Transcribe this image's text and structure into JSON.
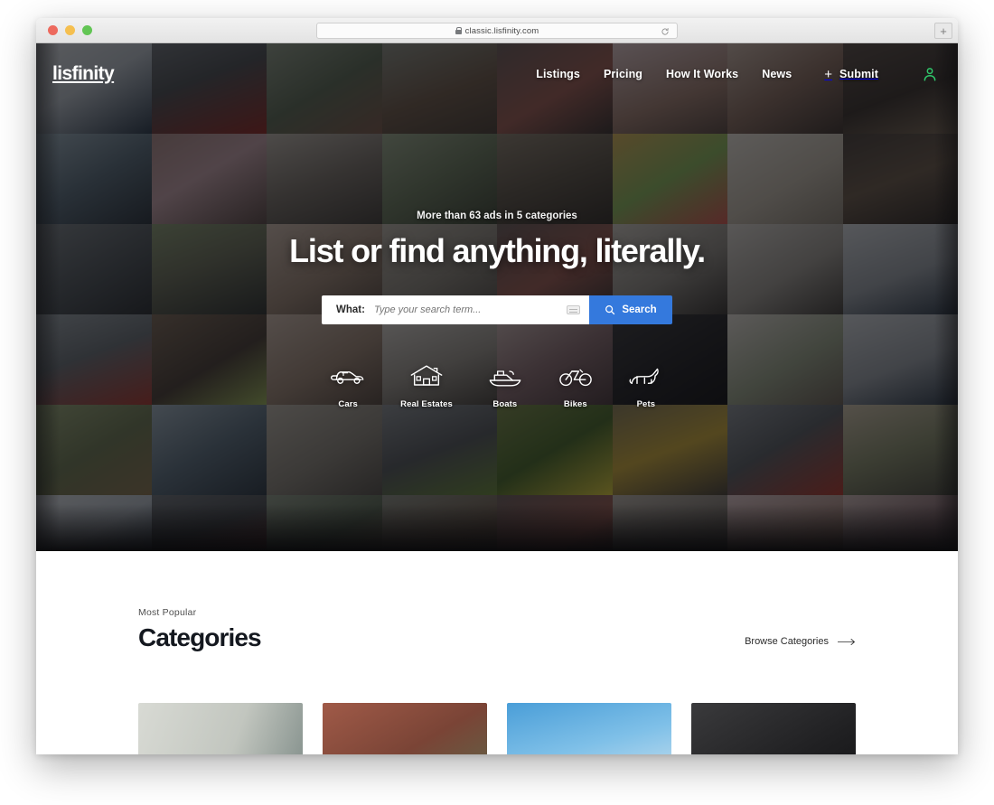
{
  "browser": {
    "url": "classic.lisfinity.com",
    "lock_icon": "lock-icon",
    "reload_icon": "reload-icon",
    "new_tab_label": "+",
    "traffic_lights": [
      "close",
      "minimize",
      "maximize"
    ]
  },
  "site": {
    "logo": "lisfinity",
    "nav": [
      {
        "label": "Listings"
      },
      {
        "label": "Pricing"
      },
      {
        "label": "How It Works"
      },
      {
        "label": "News"
      }
    ],
    "submit": {
      "icon": "plus-icon",
      "label": "Submit"
    },
    "account_icon": "user-account-icon",
    "accent_color": "#3479dd",
    "account_icon_color": "#2fc96b"
  },
  "hero": {
    "eyebrow": "More than 63 ads in 5 categories",
    "title": "List or find anything, literally.",
    "search": {
      "what_label": "What:",
      "placeholder": "Type your search term...",
      "value": "",
      "keyboard_icon": "keyboard-icon",
      "button_label": "Search",
      "button_icon": "search-icon"
    },
    "categories": [
      {
        "label": "Cars",
        "icon": "car-icon"
      },
      {
        "label": "Real Estates",
        "icon": "house-icon"
      },
      {
        "label": "Boats",
        "icon": "boat-icon"
      },
      {
        "label": "Bikes",
        "icon": "bicycle-icon"
      },
      {
        "label": "Pets",
        "icon": "dog-icon"
      }
    ]
  },
  "categories_section": {
    "eyebrow": "Most Popular",
    "title": "Categories",
    "browse_link": "Browse Categories",
    "browse_icon": "arrow-right-icon",
    "cards": [
      {
        "name": "category-card-1",
        "style": "p-wall"
      },
      {
        "name": "category-card-2",
        "style": "p-brick"
      },
      {
        "name": "category-card-3",
        "style": "p-sky"
      },
      {
        "name": "category-card-4",
        "style": "p-dark"
      }
    ]
  },
  "mosaic_tiles": [
    "p-phone",
    "p-car",
    "p-garden",
    "p-house",
    "p-scooter",
    "p-dogcone",
    "p-laptop",
    "p-books",
    "p-jetski",
    "p-boat",
    "p-bike2",
    "p-swing",
    "p-table",
    "p-blocks",
    "p-notebk",
    "p-shelf",
    "p-alley",
    "p-phones",
    "p-doll",
    "p-tiles",
    "p-scooter",
    "p-chair",
    "p-tablet",
    "p-glasses",
    "p-redcar",
    "p-barbie",
    "p-doll",
    "p-bikeg",
    "p-woman",
    "p-dark",
    "p-plant",
    "p-glasses",
    "p-stool",
    "p-boat",
    "p-tiles",
    "p-moto",
    "p-tractor",
    "p-loader",
    "p-redauto",
    "p-sofa",
    "p-phone",
    "p-car",
    "p-garden",
    "p-house",
    "p-scooter",
    "p-bike2",
    "p-dogcone",
    "p-woman",
    "p-jetski",
    "p-toys",
    "p-bikeg",
    "p-swing",
    "p-table",
    "p-blocks",
    "p-notebk",
    "p-shelf"
  ]
}
